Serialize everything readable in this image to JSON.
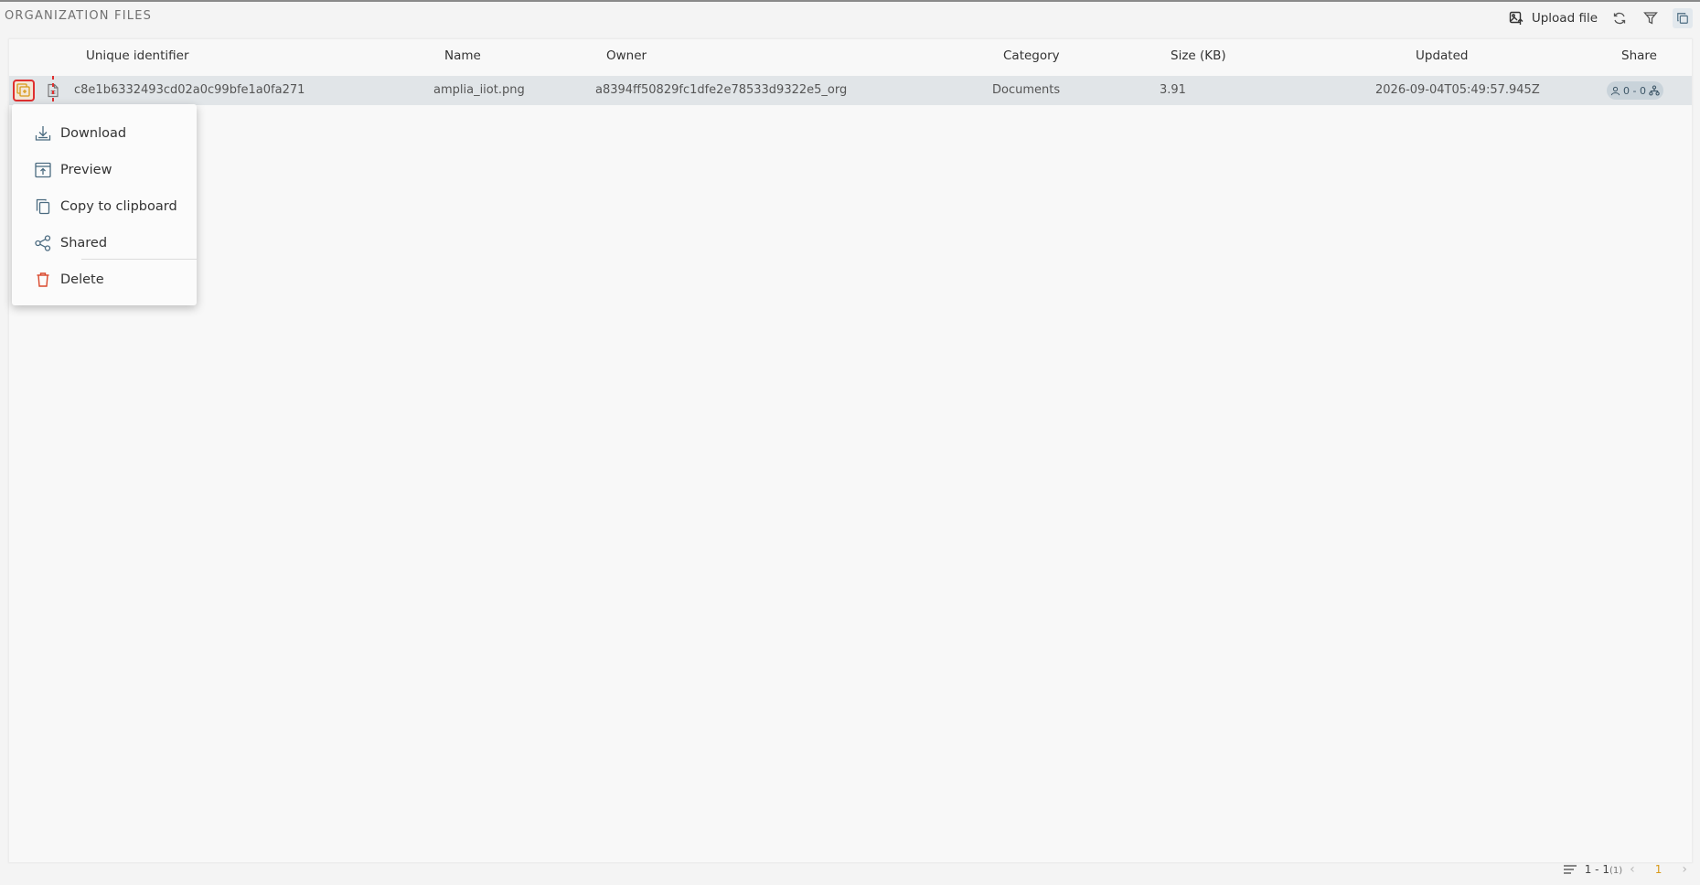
{
  "header": {
    "title": "ORGANIZATION FILES",
    "upload_label": "Upload file"
  },
  "table": {
    "columns": [
      "Unique identifier",
      "Name",
      "Owner",
      "Category",
      "Size (KB)",
      "Updated",
      "Share"
    ],
    "rows": [
      {
        "id": "c8e1b6332493cd02a0c99bfe1a0fa271",
        "name": "amplia_iiot.png",
        "owner": "a8394ff50829fc1dfe2e78533d9322e5_org",
        "category": "Documents",
        "size": "3.91",
        "updated": "2026-09-04T05:49:57.945Z",
        "share": "0 - 0"
      }
    ]
  },
  "context_menu": {
    "items": [
      {
        "label": "Download",
        "icon": "download-icon"
      },
      {
        "label": "Preview",
        "icon": "preview-icon"
      },
      {
        "label": "Copy to clipboard",
        "icon": "copy-icon"
      },
      {
        "label": "Shared",
        "icon": "share-icon"
      },
      {
        "label": "Delete",
        "icon": "trash-icon"
      }
    ]
  },
  "footer": {
    "range": "1 - 1",
    "total": "(1)",
    "current_page": "1"
  },
  "colors": {
    "accent_orange": "#d89a1b",
    "danger_red": "#d9472b",
    "highlight_red": "#e03030",
    "row_selected": "#e1e5e8",
    "share_badge": "#c9d3da"
  }
}
